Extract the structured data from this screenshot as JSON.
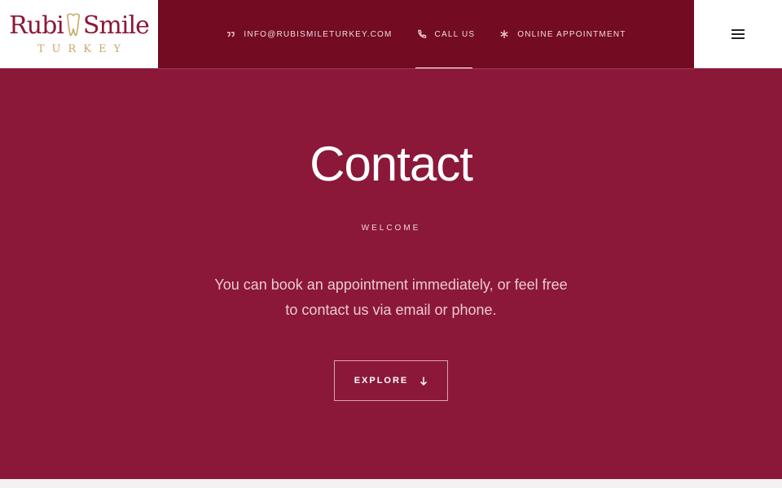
{
  "logo": {
    "word_left": "Rubi",
    "word_right": "Smile",
    "sub": "TURKEY"
  },
  "topbar": {
    "email_label": "INFO@RUBISMILETURKEY.COM",
    "call_label": "CALL US",
    "appointment_label": "ONLINE APPOINTMENT"
  },
  "icons": {
    "email": "quote-icon",
    "call": "phone-icon",
    "appointment": "asterisk-icon",
    "menu": "hamburger-menu-icon",
    "explore": "arrow-down-icon"
  },
  "hero": {
    "title": "Contact",
    "kicker": "WELCOME",
    "text": "You can book an appointment immediately, or feel free to contact us via email or phone.",
    "button_label": "EXPLORE"
  },
  "colors": {
    "brand": "#8b1838",
    "topbar": "#730b22",
    "gold": "#c7a866"
  }
}
